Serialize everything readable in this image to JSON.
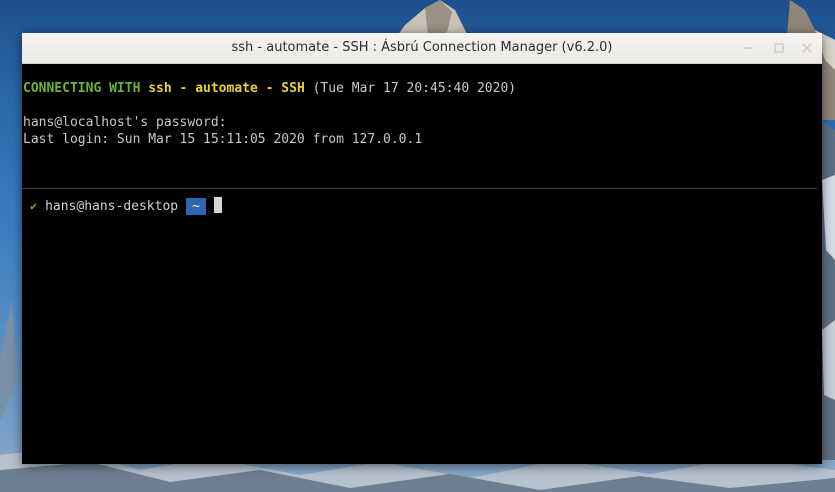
{
  "window": {
    "title": "ssh - automate - SSH : Ásbrú Connection Manager (v6.2.0)"
  },
  "terminal": {
    "line1": {
      "connecting": "CONNECTING WITH",
      "target": "ssh - automate - SSH",
      "timestamp": "(Tue Mar 17 20:45:40 2020)"
    },
    "password_prompt": "hans@localhost's password:",
    "last_login": "Last login: Sun Mar 15 15:11:05 2020 from 127.0.0.1",
    "prompt": {
      "status_icon": "✔",
      "user_host": "hans@hans-desktop",
      "directory": "~"
    }
  },
  "colors": {
    "green": "#6cb52f",
    "yellow": "#e6d33a",
    "badge_blue": "#2f65b0",
    "terminal_bg": "#000000"
  }
}
